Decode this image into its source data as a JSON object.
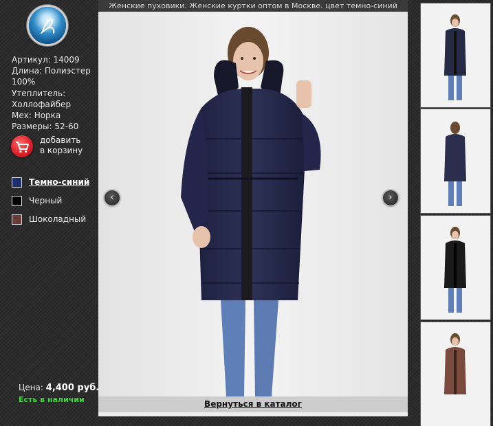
{
  "title": "Женские пуховики. Женские куртки оптом в Москве. цвет темно-синий",
  "product": {
    "article": "Артикул: 14009",
    "length_1": "Длина: Полиэстер",
    "length_2": "100%",
    "insulation_1": "Утеплитель:",
    "insulation_2": "Холлофайбер",
    "fur": "Мех: Норка",
    "sizes": "Размеры: 52-60"
  },
  "cart": {
    "label_1": "добавить",
    "label_2": "в корзину",
    "icon": "cart-icon"
  },
  "colors": [
    {
      "label": "Темно-синий",
      "swatch": "#1c2f6e",
      "active": true
    },
    {
      "label": "Черный",
      "swatch": "#000000",
      "active": false
    },
    {
      "label": "Шоколадный",
      "swatch": "#6b3b3a",
      "active": false
    }
  ],
  "price": {
    "label": "Цена:",
    "value": "4,400 руб."
  },
  "stock": "Есть в наличии",
  "back_link": "Вернуться в каталог",
  "thumbnails": [
    {
      "coat": "#262a45",
      "view": "front"
    },
    {
      "coat": "#2a2e4c",
      "view": "back"
    },
    {
      "coat": "#1a1a1a",
      "view": "front"
    },
    {
      "coat": "#7a4a3e",
      "view": "front"
    }
  ],
  "icons": {
    "prev": "chevron-left-icon",
    "next": "chevron-right-icon",
    "logo": "logo-icon"
  }
}
